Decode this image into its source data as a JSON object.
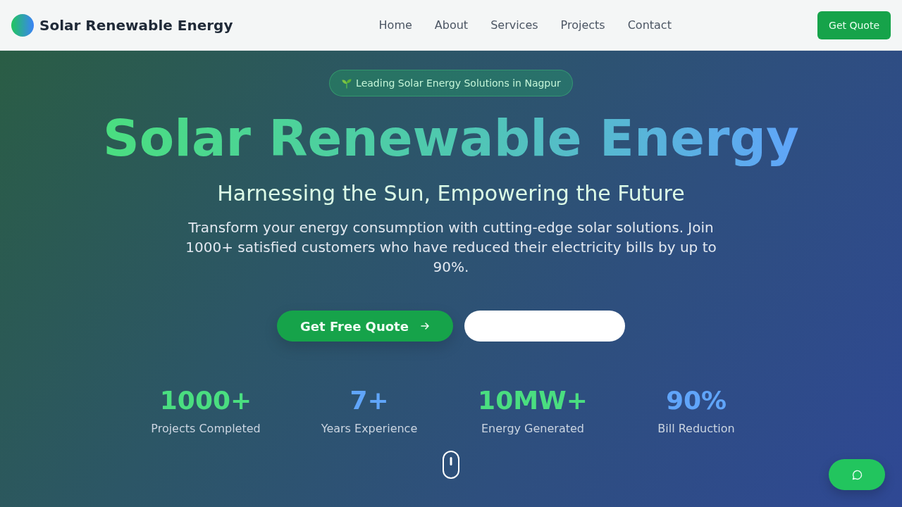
{
  "header": {
    "brand": "Solar Renewable Energy",
    "nav": [
      "Home",
      "About",
      "Services",
      "Projects",
      "Contact"
    ],
    "cta": "Get Quote"
  },
  "hero": {
    "badge": "Leading Solar Energy Solutions in Nagpur",
    "title": "Solar Renewable Energy",
    "subtitle": "Harnessing the Sun, Empowering the Future",
    "description": "Transform your energy consumption with cutting-edge solar solutions. Join 1000+ satisfied customers who have reduced their electricity bills by up to 90%.",
    "buttons": [
      {
        "kind": "primary",
        "label": "Get Free Quote"
      },
      {
        "kind": "blank"
      }
    ],
    "stats": [
      {
        "value": "1000+",
        "label": "Projects Completed",
        "color": "#4ade80"
      },
      {
        "value": "7+",
        "label": "Years Experience",
        "color": "#60a5fa"
      },
      {
        "value": "10MW+",
        "label": "Energy Generated",
        "color": "#4ade80"
      },
      {
        "value": "90%",
        "label": "Bill Reduction",
        "color": "#60a5fa"
      }
    ]
  }
}
